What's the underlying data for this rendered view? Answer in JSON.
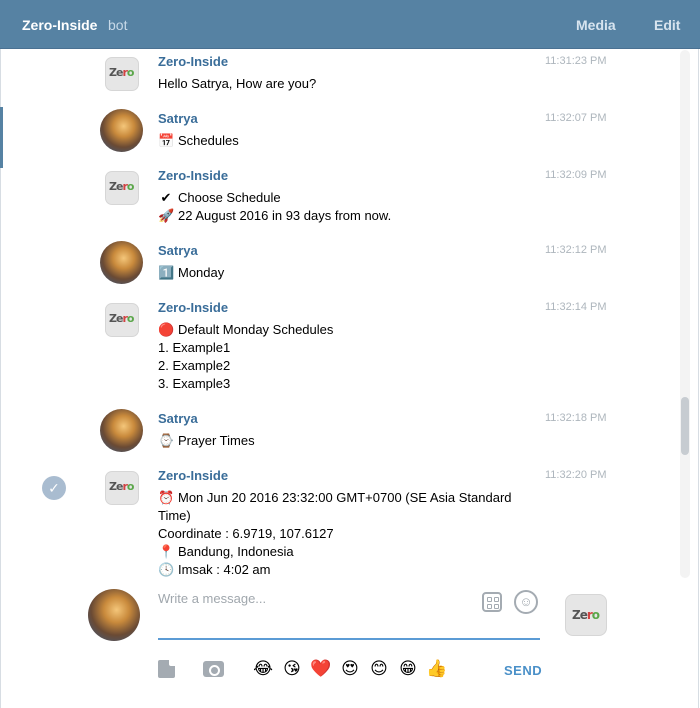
{
  "header": {
    "title": "Zero-Inside",
    "subtitle": "bot",
    "media": "Media",
    "edit": "Edit"
  },
  "messages": [
    {
      "sender": "Zero-Inside",
      "time": "11:31:23 PM",
      "lines": [
        {
          "icon": "",
          "text": "Hello Satrya, How are you?"
        }
      ]
    },
    {
      "sender": "Satrya",
      "time": "11:32:07 PM",
      "lines": [
        {
          "icon": "📅",
          "text": "Schedules"
        }
      ]
    },
    {
      "sender": "Zero-Inside",
      "time": "11:32:09 PM",
      "lines": [
        {
          "icon": "✔",
          "text": "Choose Schedule"
        },
        {
          "icon": "🚀",
          "text": "22 August 2016 in 93 days from now."
        }
      ]
    },
    {
      "sender": "Satrya",
      "time": "11:32:12 PM",
      "lines": [
        {
          "icon": "1️⃣",
          "text": "Monday"
        }
      ]
    },
    {
      "sender": "Zero-Inside",
      "time": "11:32:14 PM",
      "lines": [
        {
          "icon": "🔴",
          "text": "Default Monday Schedules"
        },
        {
          "icon": "",
          "text": "1. Example1"
        },
        {
          "icon": "",
          "text": "2. Example2"
        },
        {
          "icon": "",
          "text": "3. Example3"
        }
      ]
    },
    {
      "sender": "Satrya",
      "time": "11:32:18 PM",
      "lines": [
        {
          "icon": "⌚",
          "text": "Prayer Times"
        }
      ]
    },
    {
      "sender": "Zero-Inside",
      "time": "11:32:20 PM",
      "lines": [
        {
          "icon": "⏰",
          "text": "Mon Jun 20 2016 23:32:00 GMT+0700 (SE Asia Standard"
        },
        {
          "icon": "",
          "text": "Time)"
        },
        {
          "icon": "",
          "text": "Coordinate : 6.9719, 107.6127"
        },
        {
          "icon": "📍",
          "text": "Bandung, Indonesia"
        },
        {
          "icon": "🕓",
          "text": "Imsak    : 4:02 am"
        }
      ]
    }
  ],
  "bot_logo": {
    "a": "Z",
    "b": "e",
    "c": "r",
    "d": "o"
  },
  "compose": {
    "placeholder": "Write a message...",
    "send": "SEND",
    "emojis": [
      "😂",
      "😘",
      "❤️",
      "😍",
      "😊",
      "😁",
      "👍"
    ]
  },
  "colors": {
    "header": "#5682a3",
    "name": "#3a6d99",
    "send": "#4a90c8"
  }
}
